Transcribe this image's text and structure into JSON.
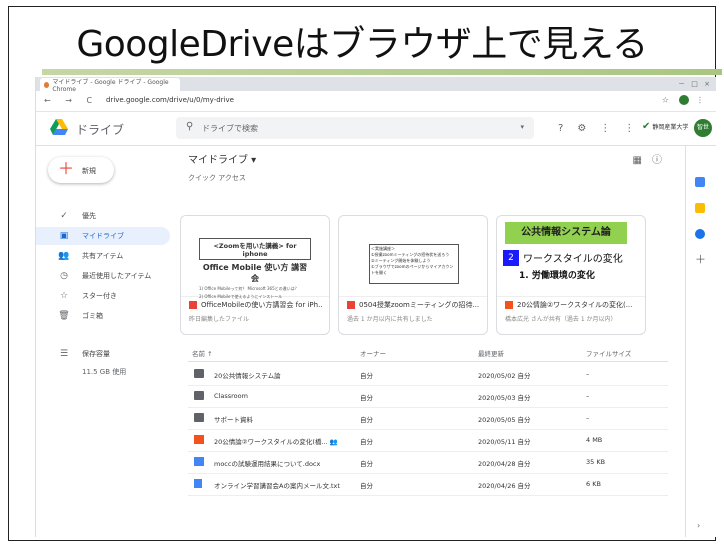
{
  "slide": {
    "title": "GoogleDriveはブラウザ上で見える"
  },
  "browser": {
    "tab_title": "マイドライブ - Google ドライブ - Google Chrome",
    "window_buttons": "－ □ ×",
    "nav": "← → C",
    "url": "drive.google.com/drive/u/0/my-drive",
    "star": "☆",
    "menu": "⋮"
  },
  "app": {
    "name": "ドライブ",
    "search_placeholder": "ドライブで検索",
    "search_icon": "search-icon",
    "org_name": "静岡産業大学",
    "user_initial": "智世"
  },
  "sidebar": {
    "new_label": "新規",
    "items": [
      {
        "icon": "✓",
        "label": "優先"
      },
      {
        "icon": "▣",
        "label": "マイドライブ"
      },
      {
        "icon": "👥",
        "label": "共有アイテム"
      },
      {
        "icon": "◷",
        "label": "最近使用したアイテム"
      },
      {
        "icon": "☆",
        "label": "スター付き"
      },
      {
        "icon": "🗑",
        "label": "ゴミ箱"
      },
      {
        "icon": "☰",
        "label": "保存容量"
      }
    ],
    "storage_used": "11.5 GB 使用"
  },
  "main": {
    "breadcrumb": "マイドライブ ▾",
    "quick_access_label": "クイック アクセス",
    "cards": [
      {
        "name": "OfficeMobileの使い方講習会 for iPh...",
        "sub": "昨日編集したファイル",
        "thumb_heading": "<Zoomを用いた講義> for iphone",
        "thumb_title": "Office Mobile 使い方 講習会",
        "thumb_line1": "1) Office Mobileって何？ Microsoft 365との違いは？",
        "thumb_line2": "2) Office Mobileで使えるようにインストール"
      },
      {
        "name": "0504授業zoomミーティングの招待...",
        "sub": "過去 1 か月以内に共有しました",
        "thumb_heading": "＜実施講座＞",
        "thumb_line1": "①授業zoomミーティングの招待状を送ろう",
        "thumb_line2": "②ミーティング開始を体験しよう",
        "thumb_line3": "①ブラウザでzoomのページからマイアカウントを開く"
      },
      {
        "name": "20公情論②ワークスタイルの変化(...",
        "sub": "橋本広光 さんが共有（過去 1 か月以内）",
        "thumb_banner": "公共情報システム論",
        "thumb_num": "2",
        "thumb_title": "ワークスタイルの変化",
        "thumb_sub": "1.  労働環境の変化"
      }
    ],
    "table": {
      "headers": [
        "名前 ↑",
        "オーナー",
        "最終更新",
        "ファイルサイズ"
      ],
      "rows": [
        {
          "type": "folder",
          "name": "20公共情報システム論",
          "owner": "自分",
          "modified": "2020/05/02 自分",
          "size": "–"
        },
        {
          "type": "folder",
          "name": "Classroom",
          "owner": "自分",
          "modified": "2020/05/03 自分",
          "size": "–"
        },
        {
          "type": "folder",
          "name": "サポート資料",
          "owner": "自分",
          "modified": "2020/05/05 自分",
          "size": "–"
        },
        {
          "type": "ppt",
          "name": "20公情論②ワークスタイルの変化(橋... 👥",
          "owner": "自分",
          "modified": "2020/05/11 自分",
          "size": "4 MB"
        },
        {
          "type": "word",
          "name": "moccの試験運用結果について.docx",
          "owner": "自分",
          "modified": "2020/04/28 自分",
          "size": "35 KB"
        },
        {
          "type": "txt",
          "name": "オンライン学習講習会Aの案内メール文.txt",
          "owner": "自分",
          "modified": "2020/04/26 自分",
          "size": "6 KB"
        }
      ]
    }
  },
  "colors": {
    "accent": "#1967d2",
    "active_bg": "#e8f0fe",
    "banner_green": "#92d050",
    "title_rule": "#a9c681"
  }
}
